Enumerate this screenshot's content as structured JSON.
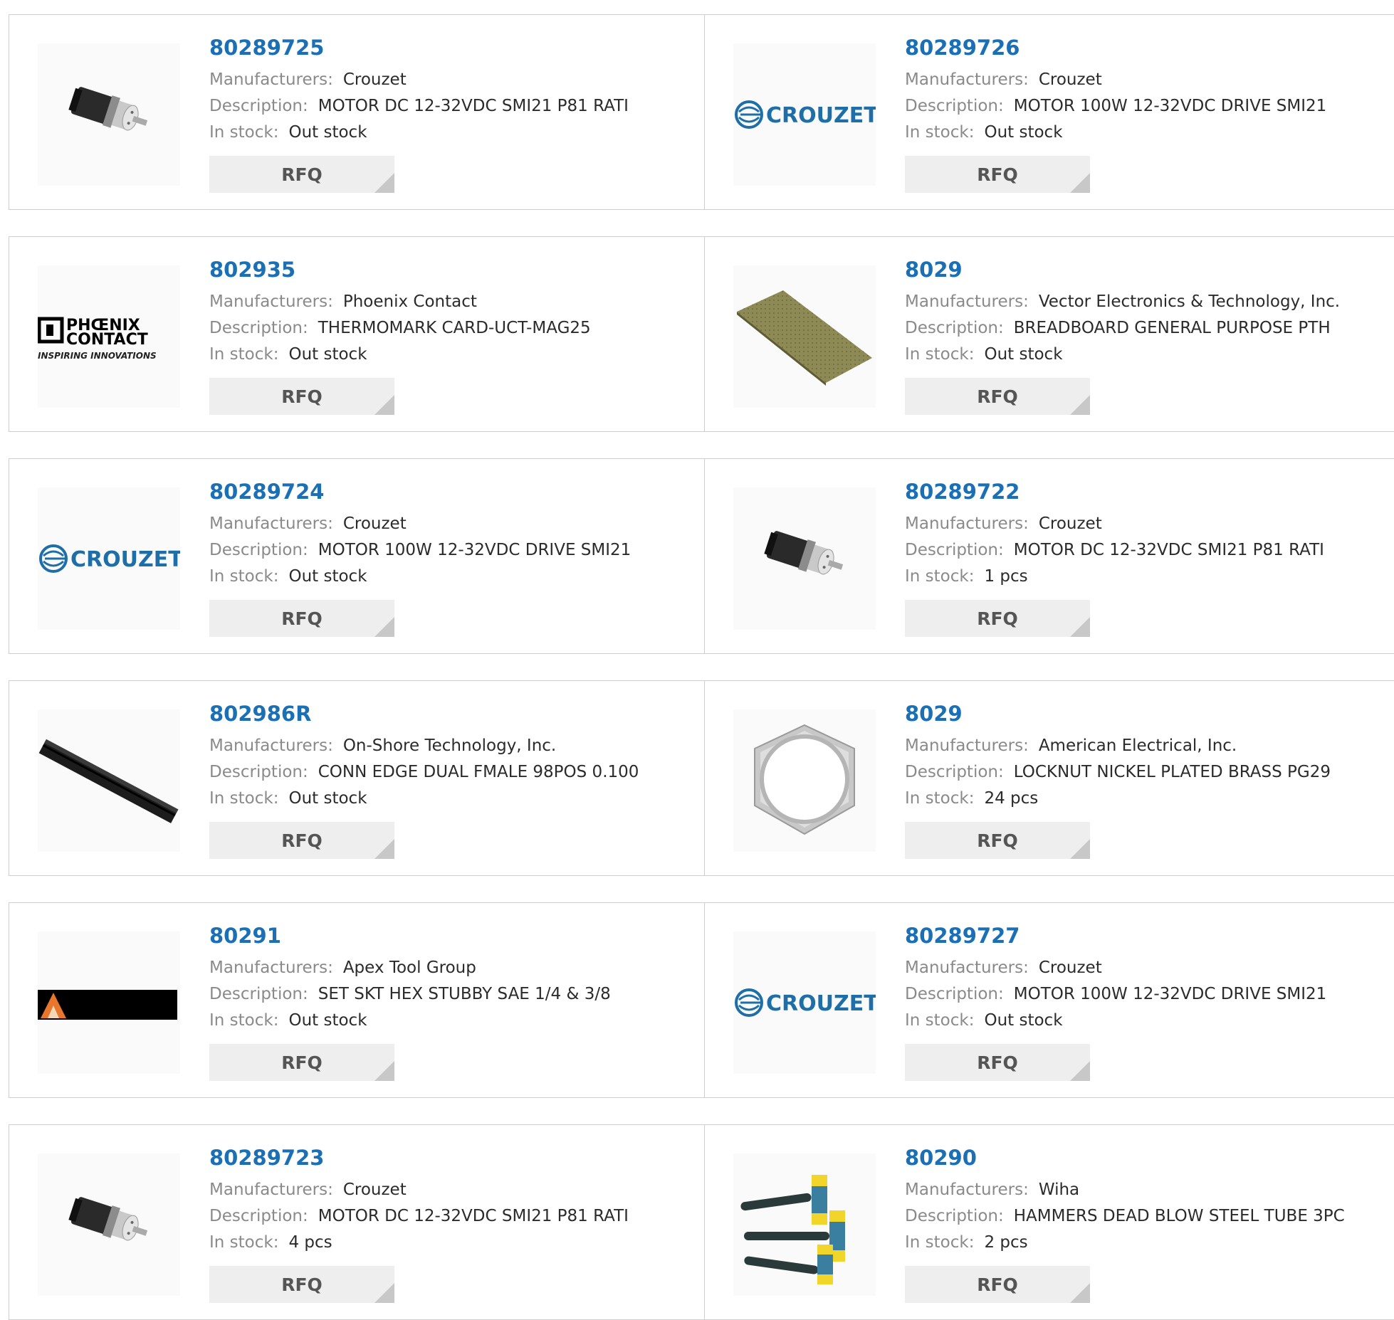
{
  "labels": {
    "manufacturers": "Manufacturers:",
    "description": "Description:",
    "in_stock": "In stock:",
    "rfq": "RFQ"
  },
  "logo_text": {
    "crouzet": "CROUZET",
    "phoenix_1": "PHŒNIX",
    "phoenix_2": "CONTACT",
    "phoenix_tag": "INSPIRING INNOVATIONS"
  },
  "colors": {
    "part_link": "#1a6fb5",
    "crouzet_blue": "#1e6fa8"
  },
  "products": [
    {
      "part": "80289725",
      "manufacturer": "Crouzet",
      "description": "MOTOR DC 12-32VDC SMI21 P81 RATI",
      "stock": "Out stock",
      "image": "motor"
    },
    {
      "part": "80289726",
      "manufacturer": "Crouzet",
      "description": "MOTOR 100W 12-32VDC DRIVE SMI21",
      "stock": "Out stock",
      "image": "crouzet-logo"
    },
    {
      "part": "802935",
      "manufacturer": "Phoenix Contact",
      "description": "THERMOMARK CARD-UCT-MAG25",
      "stock": "Out stock",
      "image": "phoenix-logo"
    },
    {
      "part": "8029",
      "manufacturer": "Vector Electronics & Technology, Inc.",
      "description": "BREADBOARD GENERAL PURPOSE PTH",
      "stock": "Out stock",
      "image": "breadboard"
    },
    {
      "part": "80289724",
      "manufacturer": "Crouzet",
      "description": "MOTOR 100W 12-32VDC DRIVE SMI21",
      "stock": "Out stock",
      "image": "crouzet-logo"
    },
    {
      "part": "80289722",
      "manufacturer": "Crouzet",
      "description": "MOTOR DC 12-32VDC SMI21 P81 RATI",
      "stock": "1 pcs",
      "image": "motor"
    },
    {
      "part": "802986R",
      "manufacturer": "On-Shore Technology, Inc.",
      "description": "CONN EDGE DUAL FMALE 98POS 0.100",
      "stock": "Out stock",
      "image": "connector"
    },
    {
      "part": "8029",
      "manufacturer": "American Electrical, Inc.",
      "description": "LOCKNUT NICKEL PLATED BRASS PG29",
      "stock": "24 pcs",
      "image": "locknut"
    },
    {
      "part": "80291",
      "manufacturer": "Apex Tool Group",
      "description": "SET SKT HEX STUBBY SAE 1/4 & 3/8",
      "stock": "Out stock",
      "image": "apex-logo"
    },
    {
      "part": "80289727",
      "manufacturer": "Crouzet",
      "description": "MOTOR 100W 12-32VDC DRIVE SMI21",
      "stock": "Out stock",
      "image": "crouzet-logo"
    },
    {
      "part": "80289723",
      "manufacturer": "Crouzet",
      "description": "MOTOR DC 12-32VDC SMI21 P81 RATI",
      "stock": "4 pcs",
      "image": "motor"
    },
    {
      "part": "80290",
      "manufacturer": "Wiha",
      "description": "HAMMERS DEAD BLOW STEEL TUBE 3PC",
      "stock": "2 pcs",
      "image": "hammers"
    }
  ]
}
